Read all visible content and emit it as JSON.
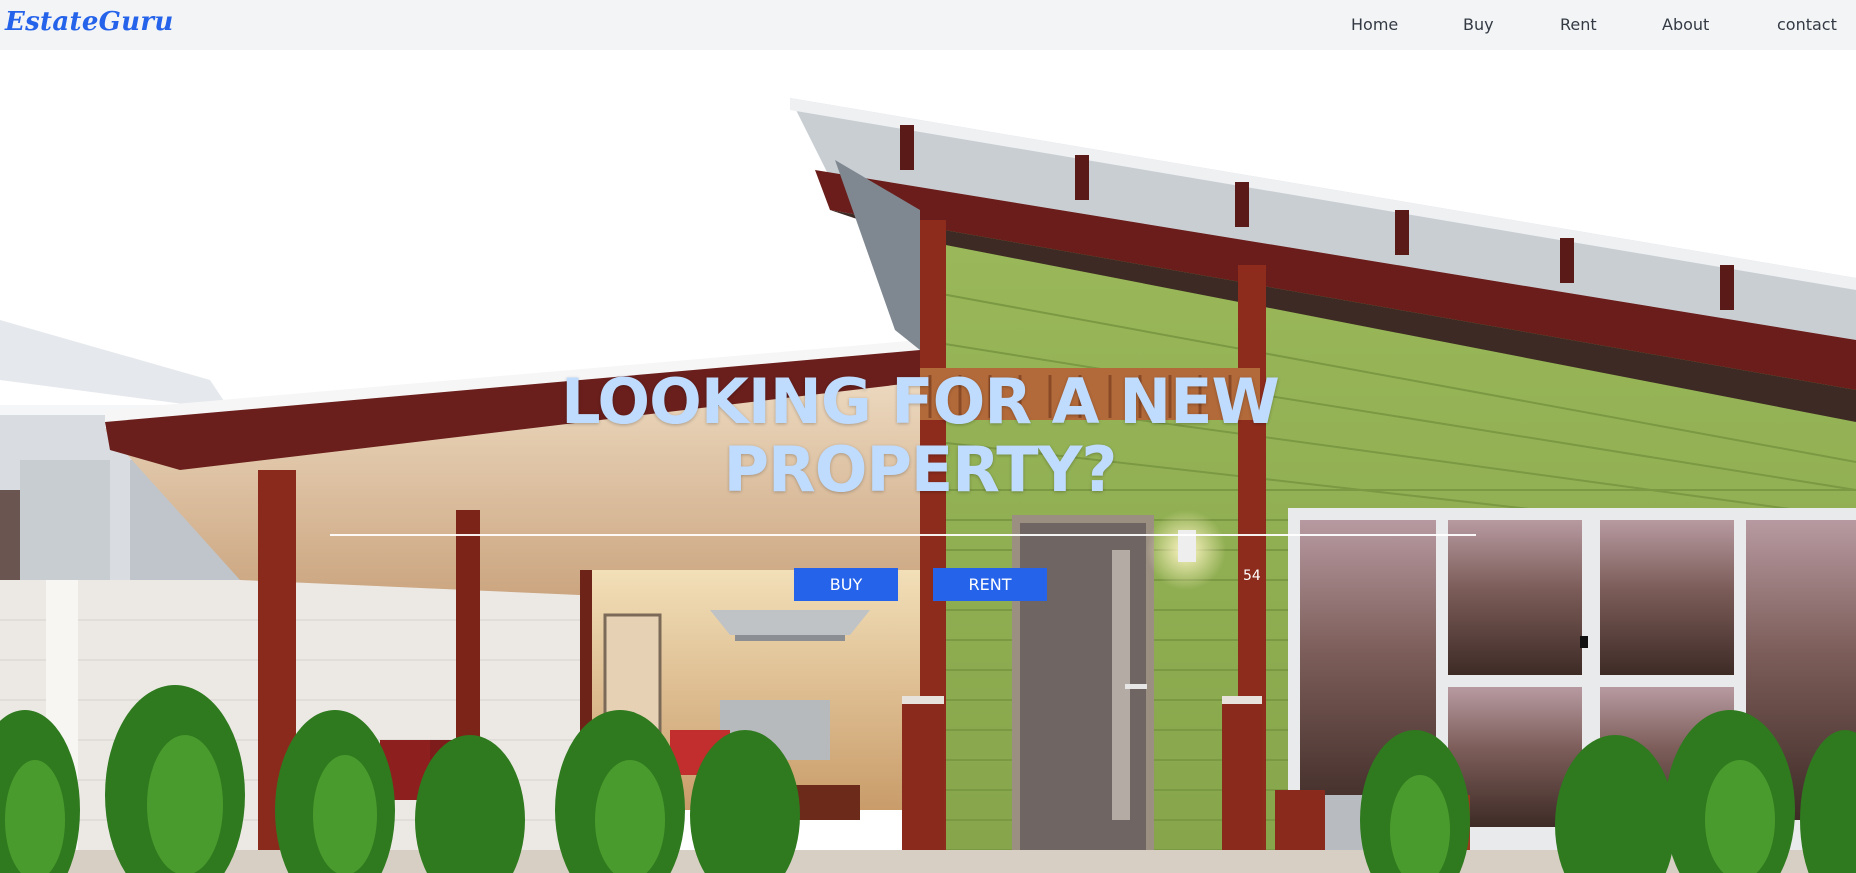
{
  "brand": {
    "name": "EstateGuru"
  },
  "nav": {
    "items": [
      {
        "label": "Home"
      },
      {
        "label": "Buy"
      },
      {
        "label": "Rent"
      },
      {
        "label": "About"
      },
      {
        "label": "contact"
      }
    ]
  },
  "hero": {
    "heading_line1": "LOOKING FOR A NEW",
    "heading_line2": "PROPERTY?",
    "buy_label": "BUY",
    "rent_label": "RENT",
    "house_number": "54"
  },
  "colors": {
    "accent": "#2563eb",
    "heading": "#bfdbfe",
    "navbar_bg": "#f3f4f6"
  }
}
